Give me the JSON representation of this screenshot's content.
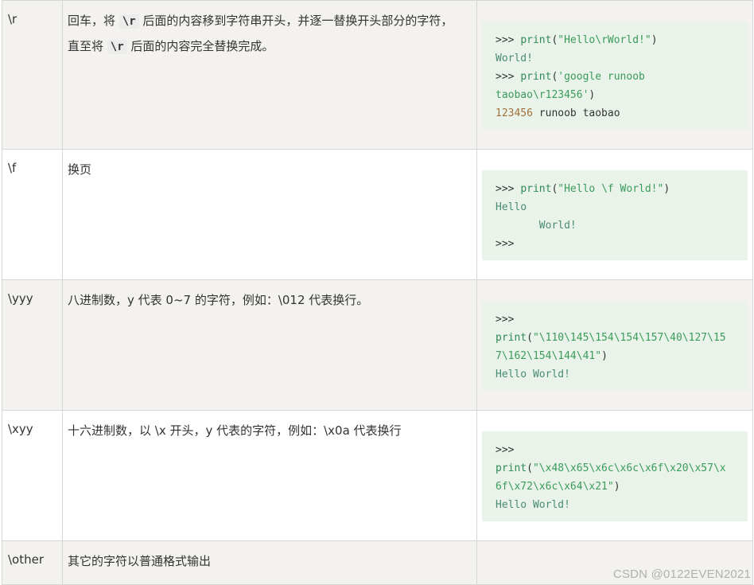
{
  "rows": [
    {
      "escape": "\\r",
      "desc_parts": [
        "回车，将 ",
        "\\r",
        " 后面的内容移到字符串开头，并逐一替换开头部分的字符，",
        "直至将 ",
        "\\r",
        " 后面的内容完全替换完成。"
      ],
      "code": {
        "l1_prompt": ">>> ",
        "l1_fn": "print",
        "l1_paren_open": "(",
        "l1_str": "\"Hello\\rWorld!\"",
        "l1_paren_close": ")",
        "l2_out": "World!",
        "l3_prompt": ">>> ",
        "l3_fn": "print",
        "l3_paren_open": "(",
        "l3_str": "'google runoob",
        "l4_str": "taobao\\r123456'",
        "l4_paren_close": ")",
        "l5_num": "123456",
        "l5_rest": " runoob taobao"
      }
    },
    {
      "escape": "\\f",
      "desc": "换页",
      "code": {
        "l1_prompt": ">>> ",
        "l1_fn": "print",
        "l1_paren_open": "(",
        "l1_str": "\"Hello \\f World!\"",
        "l1_paren_close": ")",
        "l2_out": "Hello",
        "l3_out": "       World!",
        "l4_prompt": ">>>"
      }
    },
    {
      "escape": "\\yyy",
      "desc": "八进制数，y 代表 0~7 的字符，例如：\\012 代表换行。",
      "code": {
        "l1_prompt": ">>>",
        "l2_fn": "print",
        "l2_paren_open": "(",
        "l2_str": "\"\\110\\145\\154\\154\\157\\40\\127\\15",
        "l3_str": "7\\162\\154\\144\\41\"",
        "l3_paren_close": ")",
        "l4_out": "Hello World!"
      }
    },
    {
      "escape": "\\xyy",
      "desc": "十六进制数，以 \\x 开头，y 代表的字符，例如：\\x0a 代表换行",
      "code": {
        "l1_prompt": ">>>",
        "l2_fn": "print",
        "l2_paren_open": "(",
        "l2_str": "\"\\x48\\x65\\x6c\\x6c\\x6f\\x20\\x57\\x",
        "l3_str": "6f\\x72\\x6c\\x64\\x21\"",
        "l3_paren_close": ")",
        "l4_out": "Hello World!"
      }
    },
    {
      "escape": "\\other",
      "desc": "其它的字符以普通格式输出"
    }
  ],
  "watermark": "CSDN @0122EVEN2021"
}
